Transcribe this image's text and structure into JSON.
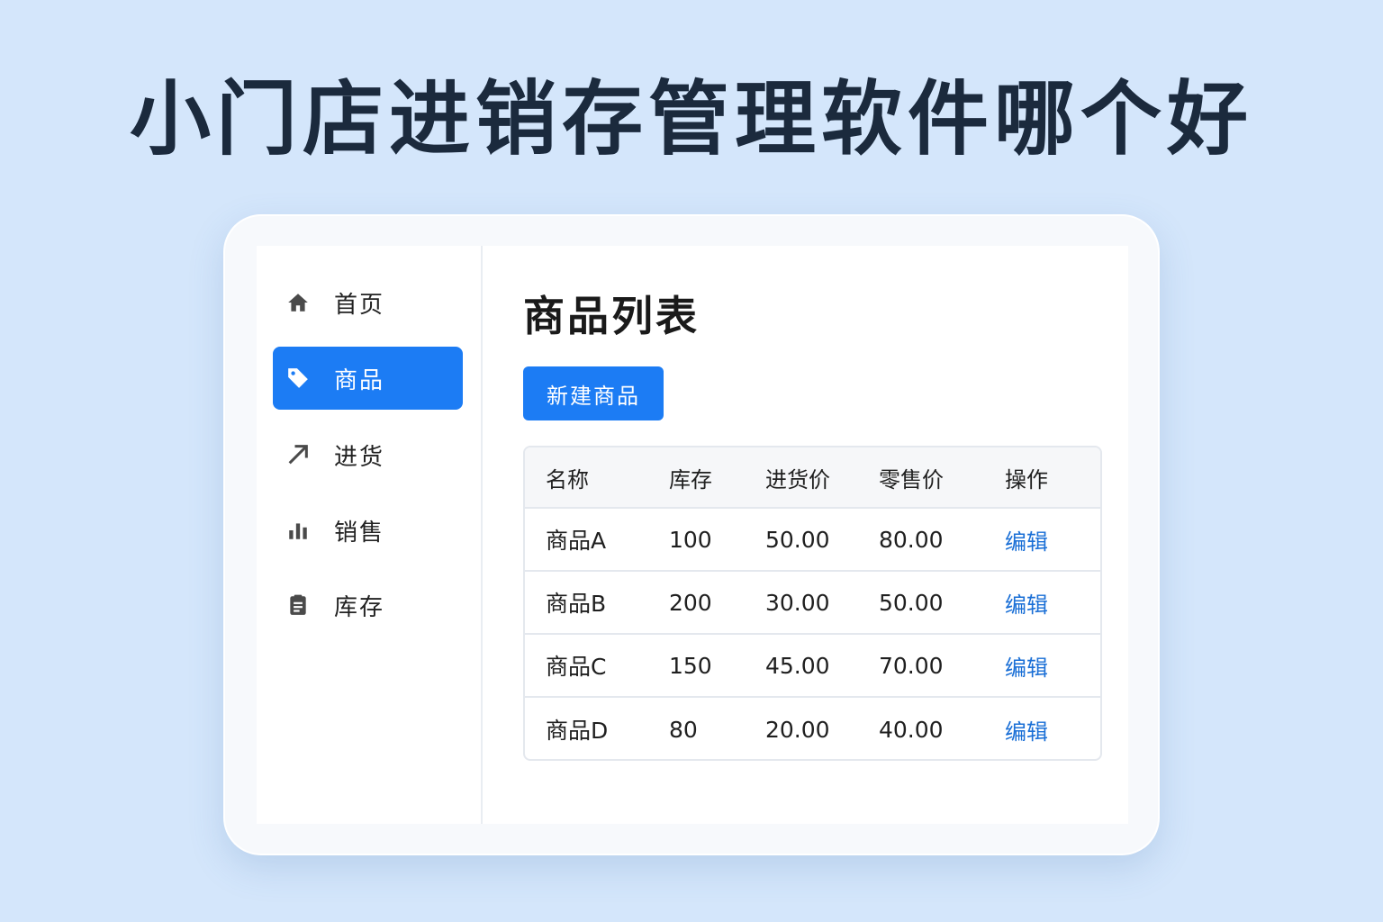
{
  "headline": "小门店进销存管理软件哪个好",
  "sidebar": {
    "items": [
      {
        "label": "首页",
        "icon": "home-icon",
        "active": false
      },
      {
        "label": "商品",
        "icon": "tag-icon",
        "active": true
      },
      {
        "label": "进货",
        "icon": "arrow-up-right-icon",
        "active": false
      },
      {
        "label": "销售",
        "icon": "bar-chart-icon",
        "active": false
      },
      {
        "label": "库存",
        "icon": "clipboard-icon",
        "active": false
      }
    ]
  },
  "main": {
    "title": "商品列表",
    "new_button": "新建商品",
    "table": {
      "headers": [
        "名称",
        "库存",
        "进货价",
        "零售价",
        "操作"
      ],
      "rows": [
        {
          "name": "商品A",
          "stock": "100",
          "purchase": "50.00",
          "retail": "80.00",
          "action": "编辑"
        },
        {
          "name": "商品B",
          "stock": "200",
          "purchase": "30.00",
          "retail": "50.00",
          "action": "编辑"
        },
        {
          "name": "商品C",
          "stock": "150",
          "purchase": "45.00",
          "retail": "70.00",
          "action": "编辑"
        },
        {
          "name": "商品D",
          "stock": "80",
          "purchase": "20.00",
          "retail": "40.00",
          "action": "编辑"
        }
      ]
    }
  },
  "colors": {
    "accent": "#1c7cf4",
    "link": "#1a6fd6",
    "background": "#d4e6fb"
  }
}
